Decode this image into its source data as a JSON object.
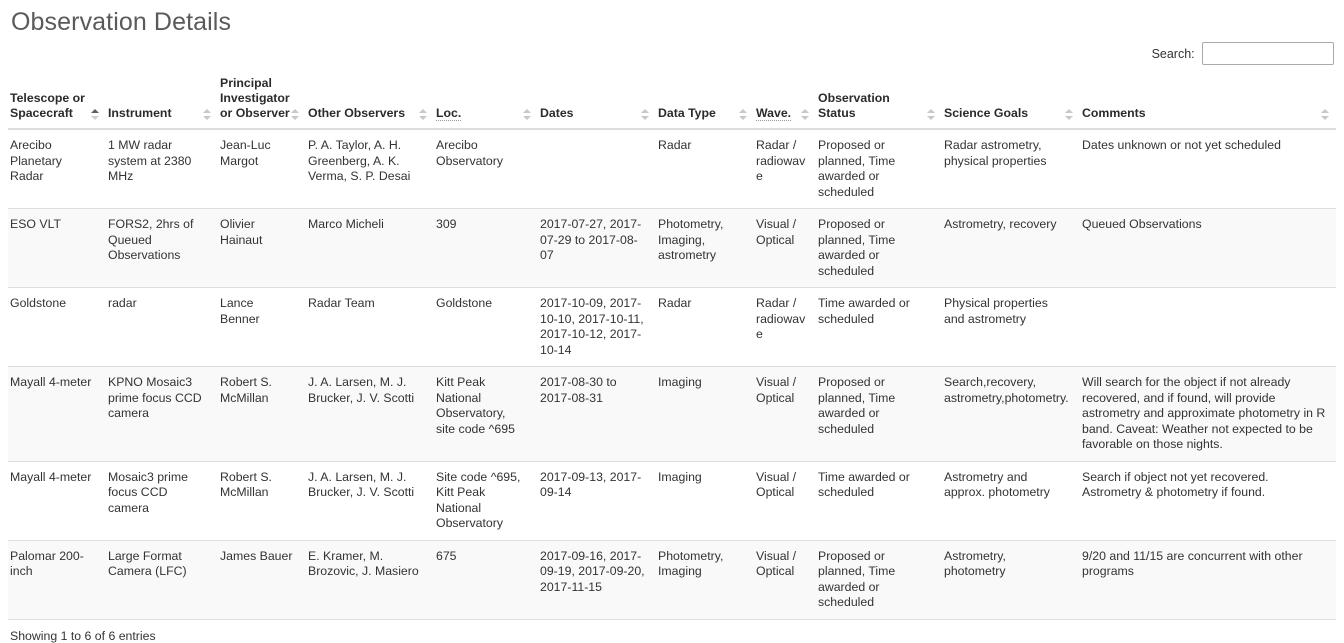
{
  "page": {
    "title": "Observation Details"
  },
  "search": {
    "label": "Search:",
    "value": "",
    "placeholder": ""
  },
  "table": {
    "columns": [
      {
        "label": "Telescope or Spacecraft",
        "sort": "asc",
        "abbr": false
      },
      {
        "label": "Instrument",
        "sort": "none",
        "abbr": false
      },
      {
        "label": "Principal Investigator or Observer",
        "sort": "none",
        "abbr": false
      },
      {
        "label": "Other Observers",
        "sort": "none",
        "abbr": false
      },
      {
        "label": "Loc.",
        "sort": "none",
        "abbr": true
      },
      {
        "label": "Dates",
        "sort": "none",
        "abbr": false
      },
      {
        "label": "Data Type",
        "sort": "none",
        "abbr": false
      },
      {
        "label": "Wave.",
        "sort": "none",
        "abbr": true
      },
      {
        "label": "Observation Status",
        "sort": "none",
        "abbr": false
      },
      {
        "label": "Science Goals",
        "sort": "none",
        "abbr": false
      },
      {
        "label": "Comments",
        "sort": "none",
        "abbr": false
      }
    ],
    "rows": [
      {
        "telescope": "Arecibo Planetary Radar",
        "instrument": "1 MW radar system at 2380 MHz",
        "pi": "Jean-Luc Margot",
        "other_observers": "P. A. Taylor, A. H. Greenberg, A. K. Verma, S. P. Desai",
        "loc": "Arecibo Observatory",
        "dates": "",
        "data_type": "Radar",
        "wave": "Radar / radiowave",
        "status": "Proposed or planned, Time awarded or scheduled",
        "science_goals": "Radar astrometry, physical properties",
        "comments": "Dates unknown or not yet scheduled"
      },
      {
        "telescope": "ESO VLT",
        "instrument": "FORS2, 2hrs of Queued Observations",
        "pi": "Olivier Hainaut",
        "other_observers": "Marco Micheli",
        "loc": "309",
        "dates": "2017-07-27, 2017-07-29 to 2017-08-07",
        "data_type": "Photometry, Imaging, astrometry",
        "wave": "Visual / Optical",
        "status": "Proposed or planned, Time awarded or scheduled",
        "science_goals": "Astrometry, recovery",
        "comments": "Queued Observations"
      },
      {
        "telescope": "Goldstone",
        "instrument": "radar",
        "pi": "Lance Benner",
        "other_observers": "Radar Team",
        "loc": "Goldstone",
        "dates": "2017-10-09, 2017-10-10, 2017-10-11, 2017-10-12, 2017-10-14",
        "data_type": "Radar",
        "wave": "Radar / radiowave",
        "status": "Time awarded or scheduled",
        "science_goals": "Physical properties and astrometry",
        "comments": ""
      },
      {
        "telescope": "Mayall 4-meter",
        "instrument": "KPNO Mosaic3 prime focus CCD camera",
        "pi": "Robert S. McMillan",
        "other_observers": "J. A. Larsen, M. J. Brucker, J. V. Scotti",
        "loc": "Kitt Peak National Observatory, site code ^695",
        "dates": "2017-08-30 to 2017-08-31",
        "data_type": "Imaging",
        "wave": "Visual / Optical",
        "status": "Proposed or planned, Time awarded or scheduled",
        "science_goals": "Search,recovery, astrometry,photometry.",
        "comments": "Will search for the object if not already recovered, and if found, will provide astrometry and approximate photometry in R band. Caveat: Weather not expected to be favorable on those nights."
      },
      {
        "telescope": "Mayall 4-meter",
        "instrument": "Mosaic3 prime focus CCD camera",
        "pi": "Robert S. McMillan",
        "other_observers": "J. A. Larsen, M. J. Brucker, J. V. Scotti",
        "loc": "Site code ^695, Kitt Peak National Observatory",
        "dates": "2017-09-13, 2017-09-14",
        "data_type": "Imaging",
        "wave": "Visual / Optical",
        "status": "Time awarded or scheduled",
        "science_goals": "Astrometry and approx. photometry",
        "comments": "Search if object not yet recovered. Astrometry & photometry if found."
      },
      {
        "telescope": "Palomar 200-inch",
        "instrument": "Large Format Camera (LFC)",
        "pi": "James Bauer",
        "other_observers": "E. Kramer, M. Brozovic, J. Masiero",
        "loc": "675",
        "dates": "2017-09-16, 2017-09-19, 2017-09-20, 2017-11-15",
        "data_type": "Photometry, Imaging",
        "wave": "Visual / Optical",
        "status": "Proposed or planned, Time awarded or scheduled",
        "science_goals": "Astrometry, photometry",
        "comments": "9/20 and 11/15 are concurrent with other programs"
      }
    ],
    "info": "Showing 1 to 6 of 6 entries"
  },
  "colors": {
    "stripe": "#f9f9f9",
    "border": "#dddddd",
    "text": "#333333",
    "title": "#5a5a5a"
  }
}
